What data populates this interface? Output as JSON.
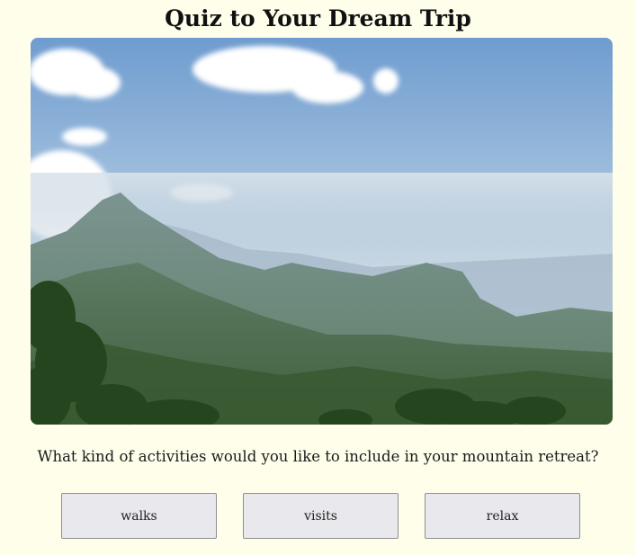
{
  "quiz": {
    "title": "Quiz to Your Dream Trip",
    "question": "What kind of activities would you like to include in your mountain retreat?",
    "options": [
      {
        "label": "walks"
      },
      {
        "label": "visits"
      },
      {
        "label": "relax"
      }
    ]
  },
  "hero_image": {
    "subject": "mountain-landscape",
    "colors": {
      "sky_top": "#6f9ccf",
      "sky_bottom": "#d6e2ec",
      "mountain_far": "#9fb5c6",
      "mountain_mid": "#6f8d86",
      "mountain_near": "#3f6a45",
      "foliage": "#23461f"
    }
  }
}
